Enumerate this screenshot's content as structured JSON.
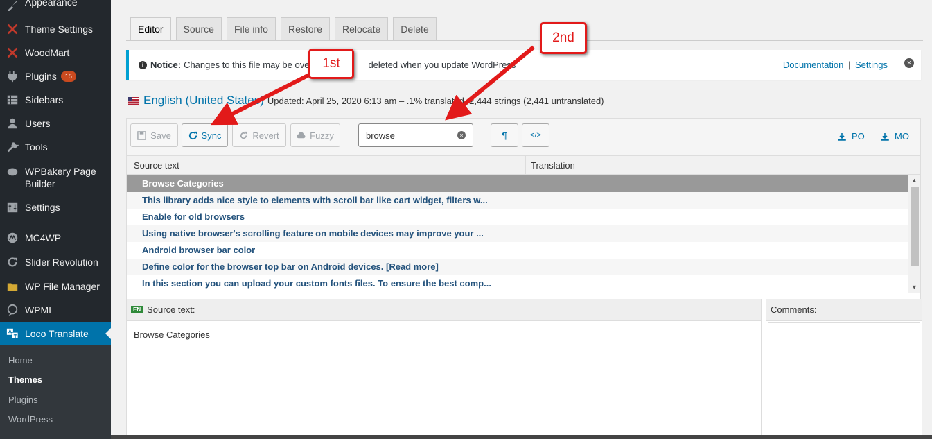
{
  "sidebar": {
    "items": [
      {
        "label": "Appearance",
        "icon": "brush-icon"
      },
      {
        "label": "Theme Settings",
        "icon": "woodmart-icon"
      },
      {
        "label": "WoodMart",
        "icon": "woodmart-icon"
      },
      {
        "label": "Plugins",
        "icon": "plugin-icon",
        "badge": "15"
      },
      {
        "label": "Sidebars",
        "icon": "sidebars-icon"
      },
      {
        "label": "Users",
        "icon": "users-icon"
      },
      {
        "label": "Tools",
        "icon": "wrench-icon"
      },
      {
        "label": "WPBakery Page Builder",
        "icon": "wpbakery-icon"
      },
      {
        "label": "Settings",
        "icon": "settings-icon"
      },
      {
        "label": "MC4WP",
        "icon": "mc4wp-icon"
      },
      {
        "label": "Slider Revolution",
        "icon": "refresh-icon"
      },
      {
        "label": "WP File Manager",
        "icon": "folder-icon"
      },
      {
        "label": "WPML",
        "icon": "wpml-icon"
      },
      {
        "label": "Loco Translate",
        "icon": "translate-icon"
      }
    ],
    "submenu": [
      "Home",
      "Themes",
      "Plugins",
      "WordPress"
    ],
    "submenu_active": "Themes"
  },
  "tabs": [
    "Editor",
    "Source",
    "File info",
    "Restore",
    "Relocate",
    "Delete"
  ],
  "active_tab": "Editor",
  "notice": {
    "bold": "Notice:",
    "text": "Changes to this file may be ove",
    "text_after": "deleted when you update WordPress",
    "link1": "Documentation",
    "sep": "|",
    "link2": "Settings"
  },
  "language": {
    "name": "English (United States)",
    "meta": "Updated: April 25, 2020 6:13 am – .1% translated, 2,444 strings (2,441 untranslated)"
  },
  "toolbar": {
    "save": "Save",
    "sync": "Sync",
    "revert": "Revert",
    "fuzzy": "Fuzzy",
    "search_value": "browse",
    "pilcrow": "¶",
    "code": "</>",
    "po": "PO",
    "mo": "MO"
  },
  "grid": {
    "col_source": "Source text",
    "col_translation": "Translation",
    "rows": [
      "Browse Categories",
      "This library adds nice style to elements with scroll bar like cart widget, filters w...",
      "Enable for old browsers",
      "Using native browser's scrolling feature on mobile devices may improve your ...",
      "Android browser bar color",
      "Define color for the browser top bar on Android devices. [Read more]",
      "In this section you can upload your custom fonts files. To ensure the best comp..."
    ]
  },
  "source_pane": {
    "lang_tag": "EN",
    "title": "Source text:",
    "text": "Browse Categories"
  },
  "comments_pane": {
    "title": "Comments:"
  },
  "annotations": {
    "first": "1st",
    "second": "2nd"
  },
  "colors": {
    "accent": "#0073aa",
    "annotation": "#e21a1a",
    "sidebar": "#23282d"
  }
}
